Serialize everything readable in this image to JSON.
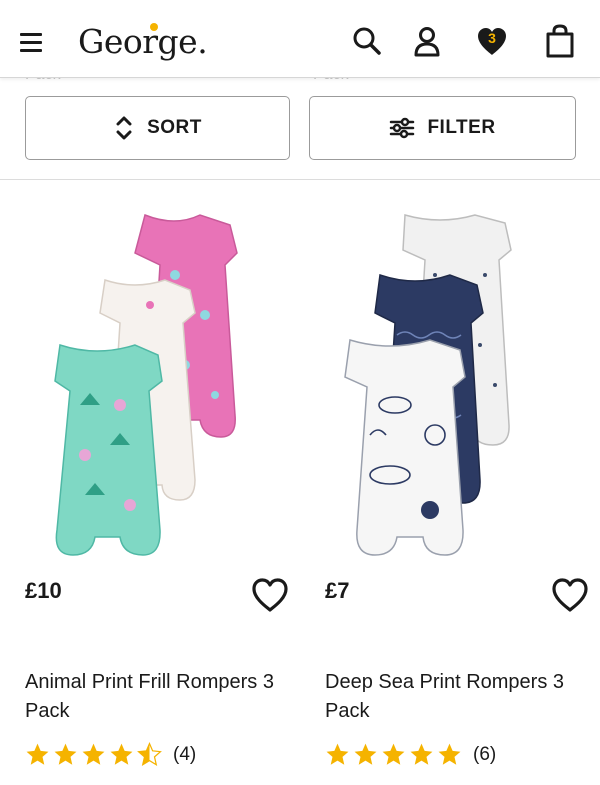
{
  "header": {
    "logo_text": "George",
    "logo_period": ".",
    "wishlist_count": "3",
    "icons": [
      "menu-icon",
      "search-icon",
      "account-icon",
      "heart-icon",
      "basket-icon"
    ]
  },
  "ghost": {
    "left": "Pack",
    "right": "Pack"
  },
  "controls": {
    "sort_label": "SORT",
    "filter_label": "FILTER"
  },
  "products": [
    {
      "price": "£10",
      "title": "Animal Print Frill Rompers 3 Pack",
      "rating_value": 4.5,
      "rating_count": "(4)"
    },
    {
      "price": "£7",
      "title": "Deep Sea Print Rompers 3 Pack",
      "rating_value": 5,
      "rating_count": "(6)"
    }
  ],
  "colors": {
    "star": "#f5b300",
    "wishlist_badge": "#f5b300",
    "text": "#1a1a1a"
  }
}
